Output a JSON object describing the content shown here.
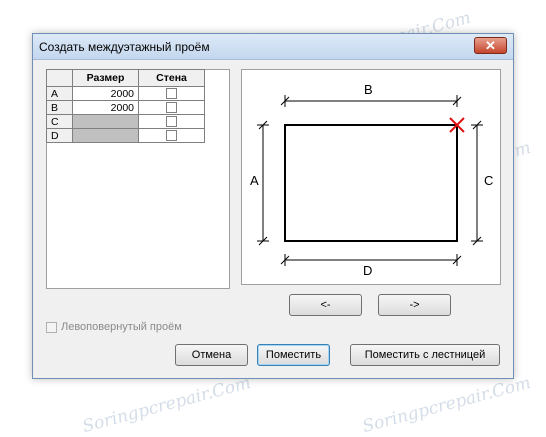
{
  "window": {
    "title": "Создать междуэтажный проём",
    "close_glyph": "✕"
  },
  "grid": {
    "headers": [
      "",
      "Размер",
      "Стена"
    ],
    "rows": [
      {
        "label": "A",
        "size": "2000",
        "enabled": true
      },
      {
        "label": "B",
        "size": "2000",
        "enabled": true
      },
      {
        "label": "C",
        "size": "",
        "enabled": false
      },
      {
        "label": "D",
        "size": "",
        "enabled": false
      }
    ]
  },
  "mirror": {
    "label": "Левоповернутый проём",
    "enabled": false,
    "checked": false
  },
  "preview": {
    "labels": {
      "a": "A",
      "b": "B",
      "c": "C",
      "d": "D"
    },
    "marker_color": "#e01010"
  },
  "nav": {
    "prev_label": "<-",
    "next_label": "->"
  },
  "footer": {
    "cancel": "Отмена",
    "place": "Поместить",
    "place_with_stairs": "Поместить с лестницей"
  },
  "watermark": "Soringpcrepair.Com"
}
